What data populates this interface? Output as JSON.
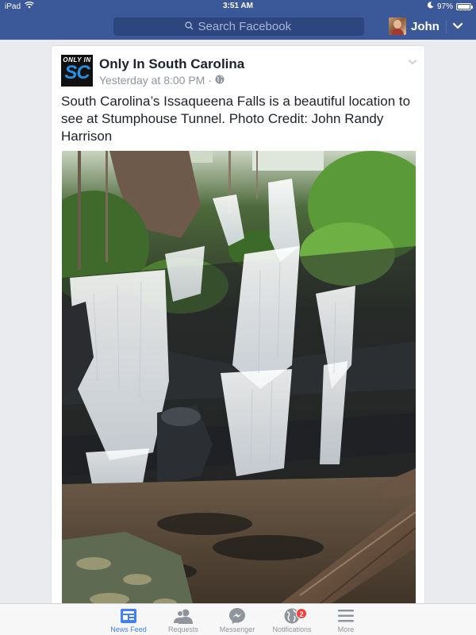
{
  "status_bar": {
    "device": "iPad",
    "time": "3:51 AM",
    "battery_percent": "97%",
    "battery_level": 0.97,
    "wifi_icon": "wifi-icon",
    "moon_icon": "do-not-disturb-icon"
  },
  "nav": {
    "search_placeholder": "Search Facebook",
    "user_name": "John"
  },
  "post": {
    "page_logo_line1": "ONLY IN",
    "page_logo_line2": "SC",
    "page_name": "Only In South Carolina",
    "timestamp": "Yesterday at 8:00 PM",
    "separator": "·",
    "privacy_icon": "globe-icon",
    "text": "South Carolina’s Issaqueena Falls is a beautiful location to see at Stumphouse Tunnel. Photo Credit: John Randy Harrison"
  },
  "tab_bar": {
    "tabs": [
      {
        "label": "News Feed",
        "icon": "news-feed-icon",
        "active": true
      },
      {
        "label": "Requests",
        "icon": "friend-requests-icon",
        "active": false
      },
      {
        "label": "Messenger",
        "icon": "messenger-icon",
        "active": false
      },
      {
        "label": "Notifications",
        "icon": "globe-notifications-icon",
        "active": false,
        "badge": "2"
      },
      {
        "label": "More",
        "icon": "menu-icon",
        "active": false
      }
    ]
  },
  "colors": {
    "brand": "#3b5998",
    "active_tab": "#4080ff",
    "badge": "#fa3e3e",
    "background": "#e9ebee"
  }
}
